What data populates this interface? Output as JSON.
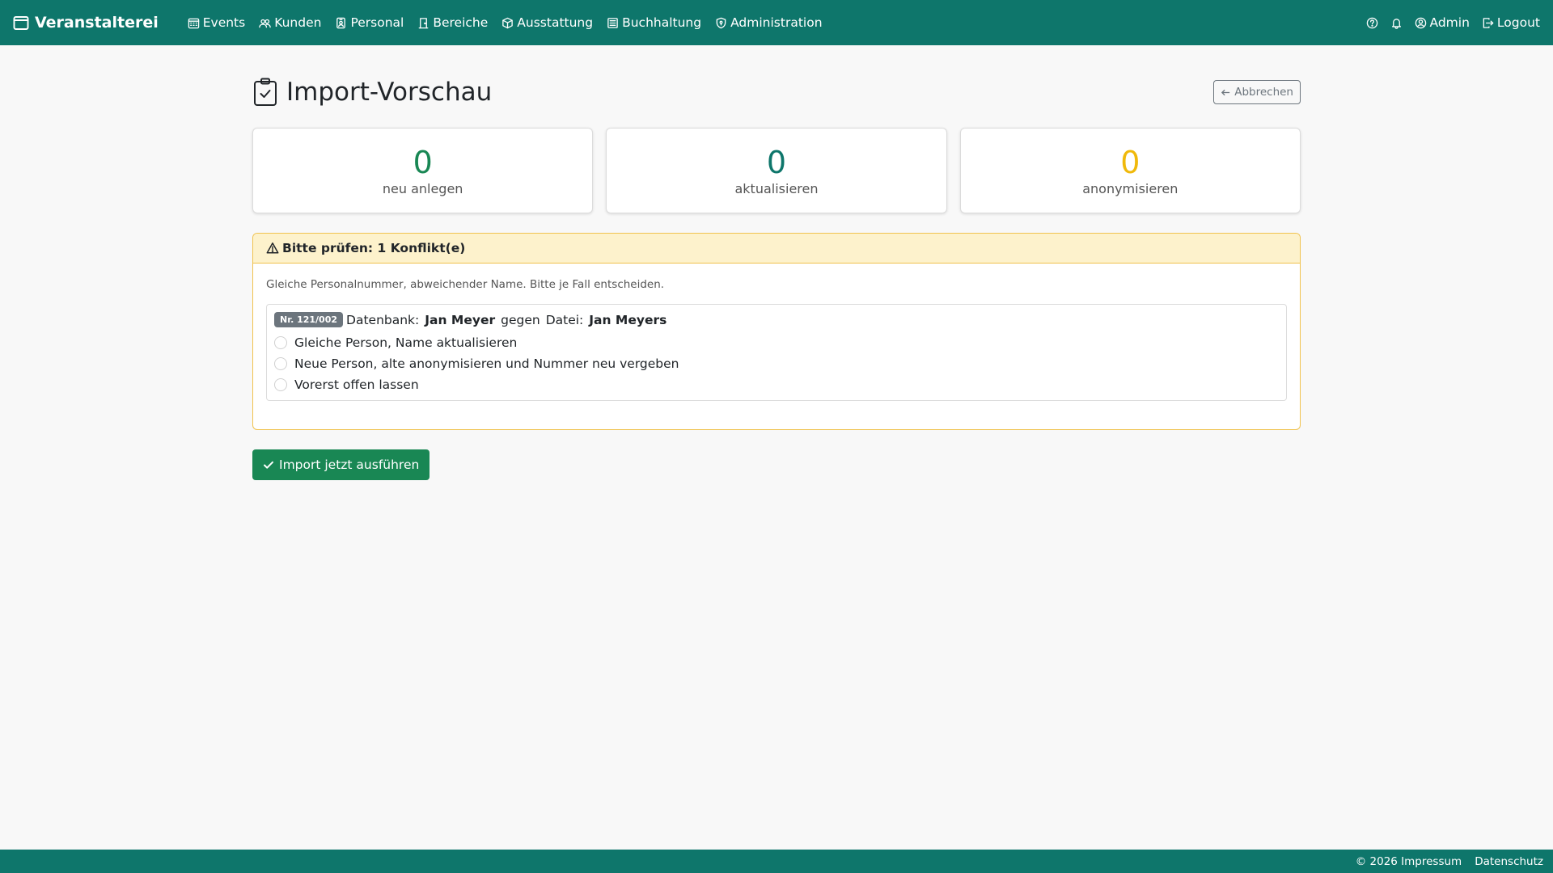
{
  "app": {
    "brand": "Veranstalterei"
  },
  "nav": {
    "items": [
      {
        "label": "Events",
        "icon": "calendar-grid-icon"
      },
      {
        "label": "Kunden",
        "icon": "people-icon"
      },
      {
        "label": "Personal",
        "icon": "person-badge-icon"
      },
      {
        "label": "Bereiche",
        "icon": "door-icon"
      },
      {
        "label": "Ausstattung",
        "icon": "box-icon"
      },
      {
        "label": "Buchhaltung",
        "icon": "ledger-icon"
      },
      {
        "label": "Administration",
        "icon": "shield-icon"
      }
    ],
    "user": "Admin",
    "logout": "Logout"
  },
  "page": {
    "title": "Import-Vorschau",
    "cancel_label": "Abbrechen"
  },
  "stats": [
    {
      "value": "0",
      "label": "neu anlegen",
      "color": "#198754"
    },
    {
      "value": "0",
      "label": "aktualisieren",
      "color": "#0e766b"
    },
    {
      "value": "0",
      "label": "anonymisieren",
      "color": "#f0b90b"
    }
  ],
  "conflicts": {
    "header": "Bitte prüfen: 1 Konflikt(e)",
    "description": "Gleiche Personalnummer, abweichender Name. Bitte je Fall entscheiden.",
    "items": [
      {
        "badge": "Nr. 121/002",
        "db_label": "Datenbank:",
        "db_name": "Jan Meyer",
        "versus": "gegen",
        "file_label": "Datei:",
        "file_name": "Jan Meyers",
        "options": [
          "Gleiche Person, Name aktualisieren",
          "Neue Person, alte anonymisieren und Nummer neu vergeben",
          "Vorerst offen lassen"
        ]
      }
    ]
  },
  "actions": {
    "run_label": "Import jetzt ausführen"
  },
  "footer": {
    "impressum": "© 2026 Impressum",
    "datenschutz": "Datenschutz"
  },
  "colors": {
    "primary": "#0e766b",
    "success": "#198754",
    "warning": "#f0c24e",
    "warning_bg": "#fdf2cc"
  }
}
